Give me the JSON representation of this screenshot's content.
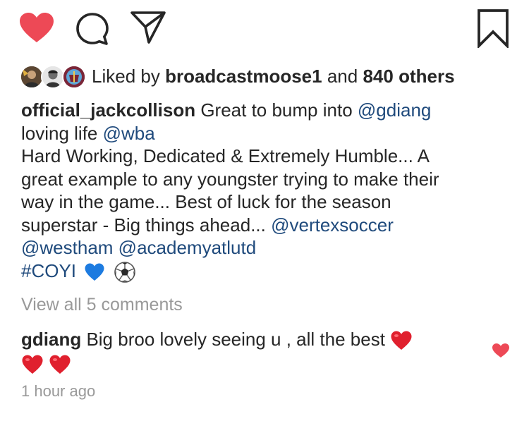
{
  "actions": {
    "like_icon": "heart-filled-icon",
    "comment_icon": "comment-bubble-icon",
    "share_icon": "paper-plane-icon",
    "save_icon": "bookmark-icon",
    "like_color": "#ed4956"
  },
  "likes": {
    "prefix": "Liked by",
    "first_liker": "broadcastmoose1",
    "connector": "and",
    "others": "840 others"
  },
  "caption": {
    "author": "official_jackcollison",
    "line1_text": " Great to bump into ",
    "mention1": "@gdiang",
    "line2_text": "loving life ",
    "mention2": "@wba",
    "line3": "Hard Working, Dedicated & Extremely Humble... A",
    "line4": "great example to any youngster trying to make their",
    "line5": "way in the game... Best of luck for the season",
    "line6_text": "superstar - Big things ahead... ",
    "mention3": "@vertexsoccer",
    "mention4": "@westham",
    "mention5": "@academyatlutd",
    "hashtag": "#COYI"
  },
  "view_all_comments": "View all 5 comments",
  "comment": {
    "author": "gdiang",
    "text": " Big broo lovely seeing u , all the best "
  },
  "timestamp": "1 hour ago"
}
